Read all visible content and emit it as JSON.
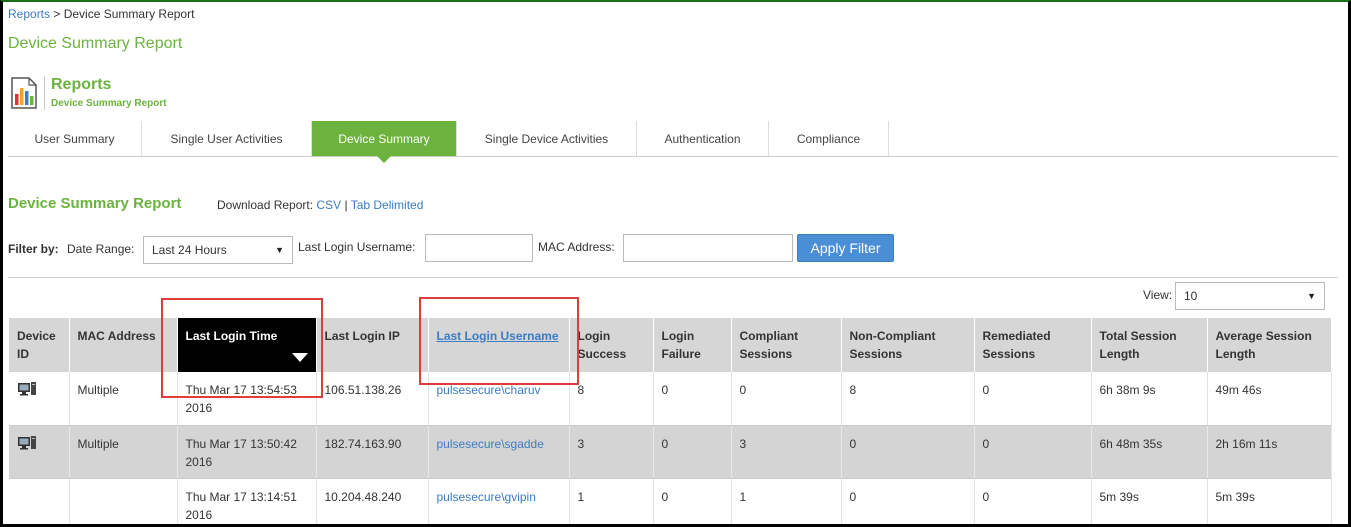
{
  "breadcrumb": {
    "link": "Reports",
    "separator": " > ",
    "current": "Device Summary Report"
  },
  "page_title": "Device Summary Report",
  "header": {
    "title": "Reports",
    "subtitle": "Device Summary Report",
    "icon": "report-chart-icon"
  },
  "tabs": [
    {
      "label": "User Summary",
      "active": false
    },
    {
      "label": "Single User Activities",
      "active": false
    },
    {
      "label": "Device Summary",
      "active": true
    },
    {
      "label": "Single Device Activities",
      "active": false
    },
    {
      "label": "Authentication",
      "active": false
    },
    {
      "label": "Compliance",
      "active": false
    }
  ],
  "section": {
    "title": "Device Summary Report",
    "download_label": "Download Report:",
    "csv_link": "CSV",
    "separator": "|",
    "tab_link": "Tab Delimited"
  },
  "filter": {
    "filter_by": "Filter by:",
    "date_range_label": "Date Range:",
    "date_range_value": "Last 24 Hours",
    "username_label": "Last Login Username:",
    "username_value": "",
    "mac_label": "MAC Address:",
    "mac_value": "",
    "apply_label": "Apply Filter"
  },
  "view": {
    "label": "View:",
    "value": "10"
  },
  "table": {
    "columns": [
      {
        "label": "Device ID"
      },
      {
        "label": "MAC Address"
      },
      {
        "label": "Last Login Time",
        "sorted": true
      },
      {
        "label": "Last Login IP"
      },
      {
        "label": "Last Login Username",
        "link": true
      },
      {
        "label": "Login Success"
      },
      {
        "label": "Login Failure"
      },
      {
        "label": "Compliant Sessions"
      },
      {
        "label": "Non-Compliant Sessions"
      },
      {
        "label": "Remediated Sessions"
      },
      {
        "label": "Total Session Length"
      },
      {
        "label": "Average Session Length"
      }
    ],
    "rows": [
      {
        "device_icon": "computer-icon",
        "mac": "Multiple",
        "time": "Thu Mar 17 13:54:53 2016",
        "ip": "106.51.138.26",
        "username": "pulsesecure\\charuv",
        "success": "8",
        "failure": "0",
        "compliant": "0",
        "noncompliant": "8",
        "remediated": "0",
        "total": "6h 38m 9s",
        "average": "49m 46s"
      },
      {
        "device_icon": "computer-icon",
        "mac": "Multiple",
        "time": "Thu Mar 17 13:50:42 2016",
        "ip": "182.74.163.90",
        "username": "pulsesecure\\sgadde",
        "success": "3",
        "failure": "0",
        "compliant": "3",
        "noncompliant": "0",
        "remediated": "0",
        "total": "6h 48m 35s",
        "average": "2h 16m 11s"
      },
      {
        "device_icon": "",
        "mac": "",
        "time": "Thu Mar 17 13:14:51 2016",
        "ip": "10.204.48.240",
        "username": "pulsesecure\\gvipin",
        "success": "1",
        "failure": "0",
        "compliant": "1",
        "noncompliant": "0",
        "remediated": "0",
        "total": "5m 39s",
        "average": "5m 39s"
      }
    ]
  },
  "colors": {
    "accent": "#6cb33e",
    "link": "#3b7cc2",
    "highlight": "#e03c3c",
    "button": "#4a8fd6"
  }
}
